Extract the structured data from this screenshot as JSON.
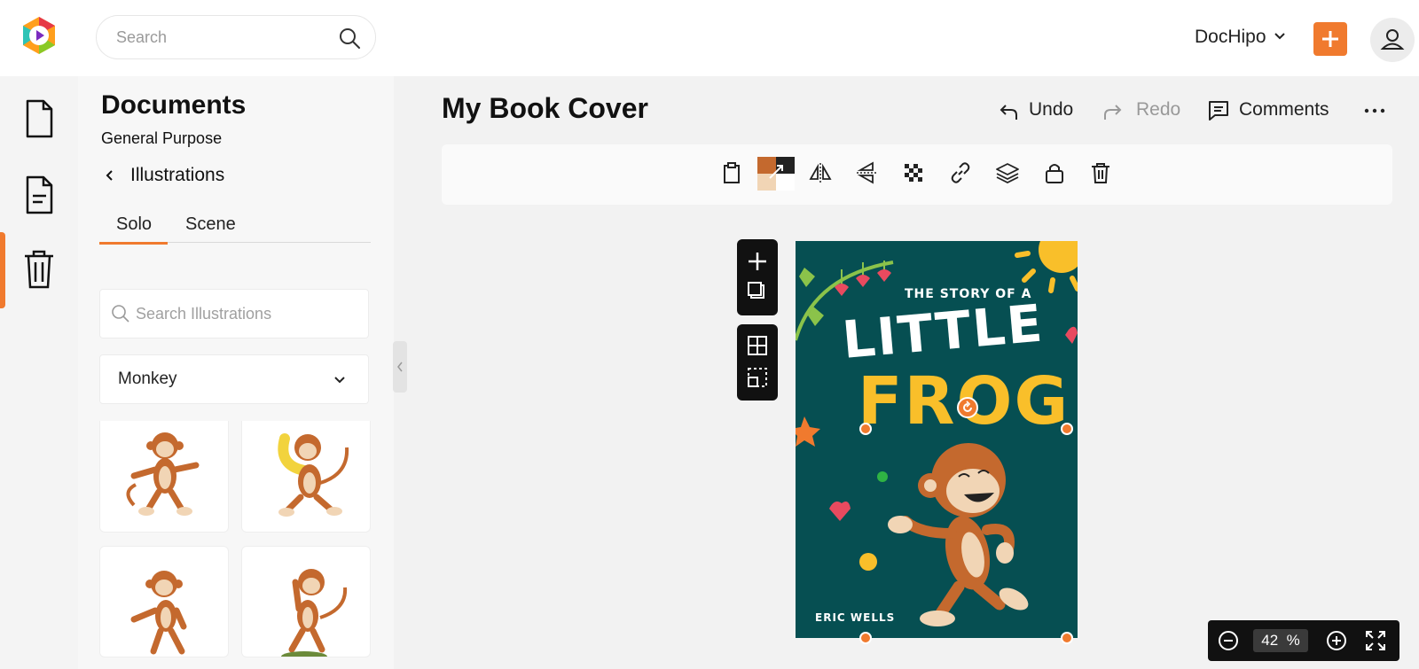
{
  "header": {
    "search_placeholder": "Search",
    "brand": "DocHipo",
    "accent_color": "#f07a2e"
  },
  "rail": {
    "items": [
      "document-icon",
      "document-text-icon",
      "trash-icon"
    ],
    "active_index": 1
  },
  "panel": {
    "title": "Documents",
    "subtitle": "General Purpose",
    "breadcrumb": "Illustrations",
    "tabs": [
      {
        "label": "Solo",
        "active": true
      },
      {
        "label": "Scene",
        "active": false
      }
    ],
    "search_placeholder": "Search Illustrations",
    "category": "Monkey"
  },
  "editor": {
    "doc_title": "My Book Cover",
    "undo_label": "Undo",
    "redo_label": "Redo",
    "comments_label": "Comments"
  },
  "cover": {
    "title_small": "The Story of a",
    "title_line1": "LITTLE",
    "title_line2": "FROG",
    "author": "Eric Wells",
    "bg_color": "#064f52",
    "title_color": "#f9bf2a"
  },
  "zoom": {
    "value": "42",
    "unit": "%"
  }
}
